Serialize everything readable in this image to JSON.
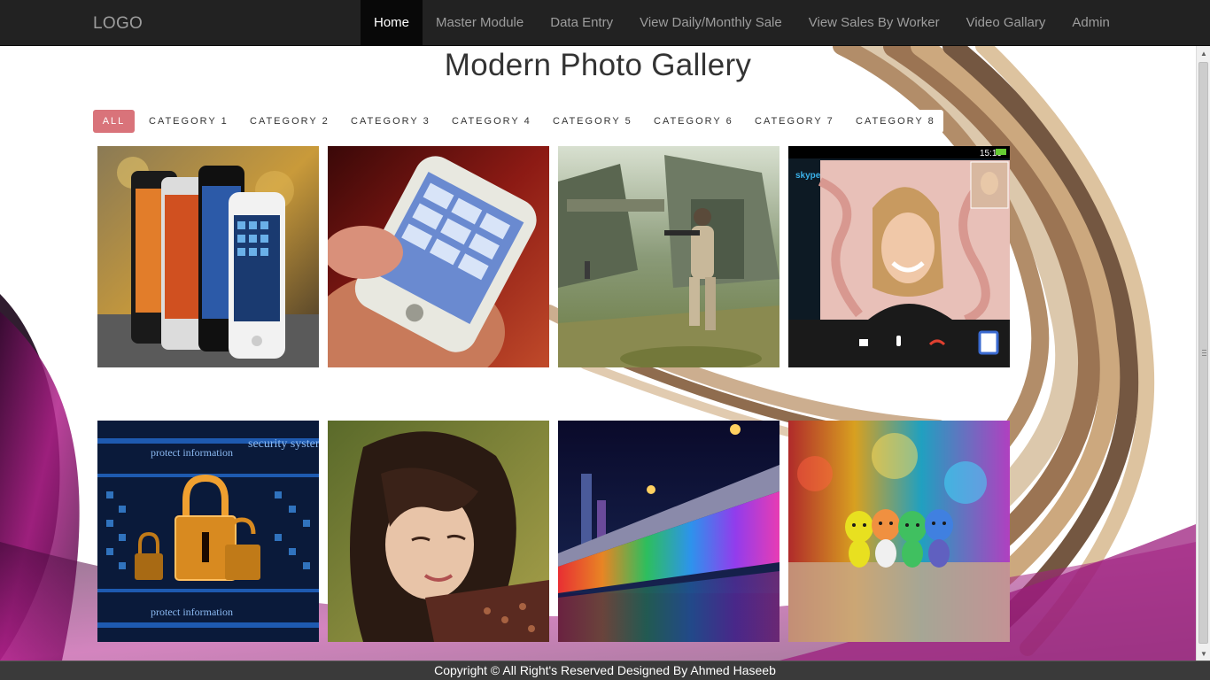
{
  "navbar": {
    "logo": "LOGO",
    "items": [
      {
        "label": "Home",
        "active": true
      },
      {
        "label": "Master Module"
      },
      {
        "label": "Data Entry"
      },
      {
        "label": "View Daily/Monthly Sale"
      },
      {
        "label": "View Sales By Worker"
      },
      {
        "label": "Video Gallary"
      },
      {
        "label": "Admin"
      }
    ]
  },
  "page": {
    "title": "Modern Photo Gallery"
  },
  "filters": [
    "ALL",
    "CATEGORY 1",
    "CATEGORY 2",
    "CATEGORY 3",
    "CATEGORY 4",
    "CATEGORY 5",
    "CATEGORY 6",
    "CATEGORY 7",
    "CATEGORY 8"
  ],
  "colors": {
    "navbar_bg": "#222222",
    "nav_active_bg": "#080808",
    "filter_active_bg": "#d9737a",
    "footer_bg": "#3a3a3a",
    "accent_magenta": "#8a1a6e"
  },
  "gallery": [
    {
      "name": "smartphones-lineup-photo"
    },
    {
      "name": "hand-holding-phone-photo"
    },
    {
      "name": "game-soldier-ruins-photo"
    },
    {
      "name": "video-call-woman-photo",
      "status_time": "15:19",
      "app_label": "skype"
    },
    {
      "name": "security-padlock-photo",
      "overlay_text": [
        "security system",
        "protect information"
      ]
    },
    {
      "name": "girl-portrait-photo"
    },
    {
      "name": "rainbow-bridge-fountain-photo"
    },
    {
      "name": "colorful-toys-photo"
    }
  ],
  "footer": {
    "text": "Copyright © All Right's Reserved Designed By Ahmed Haseeb"
  }
}
